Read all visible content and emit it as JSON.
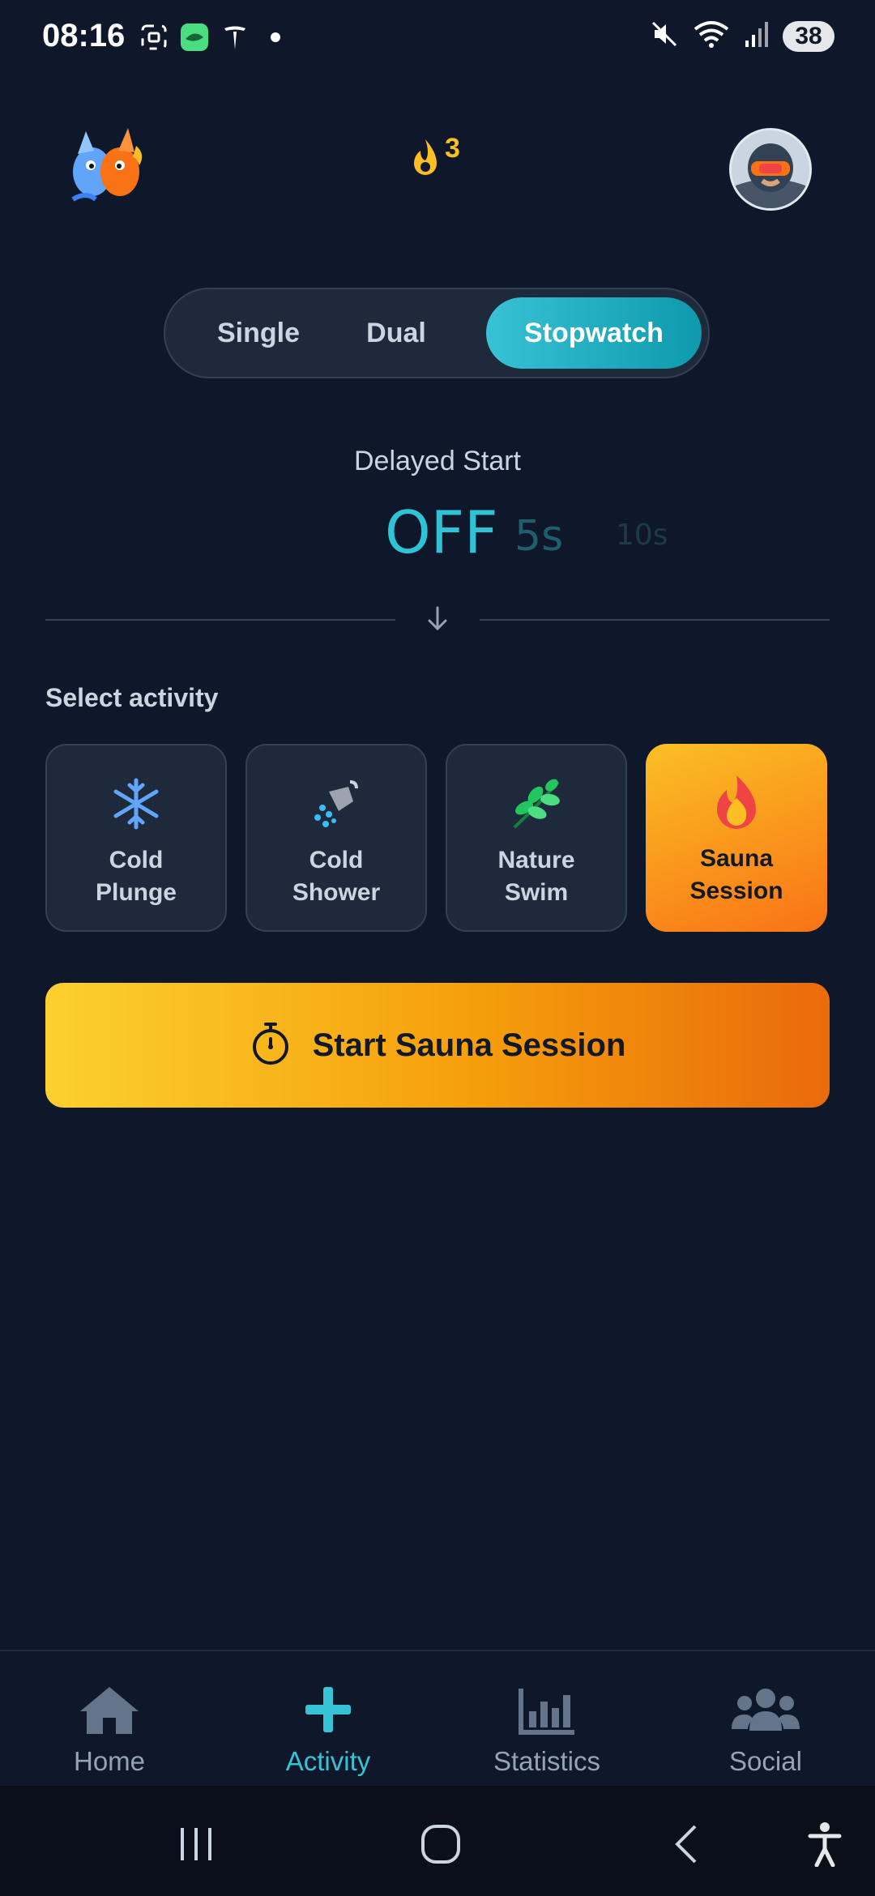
{
  "status_bar": {
    "time": "08:16",
    "battery": "38",
    "icons": [
      "screenshot-icon",
      "app-notification-icon",
      "tesla-icon",
      "dot-icon",
      "mute-icon",
      "wifi-icon",
      "signal-icon"
    ]
  },
  "header": {
    "streak_count": "3",
    "mascot": "fire-ice-dragon-mascot",
    "avatar": "user-avatar"
  },
  "mode_tabs": [
    {
      "label": "Single",
      "active": false
    },
    {
      "label": "Dual",
      "active": false
    },
    {
      "label": "Stopwatch",
      "active": true
    }
  ],
  "delayed_start": {
    "label": "Delayed Start",
    "options": [
      "OFF",
      "5s",
      "10s"
    ],
    "selected": "OFF"
  },
  "activity": {
    "label": "Select activity",
    "items": [
      {
        "label": "Cold\nPlunge",
        "icon": "snowflake-icon",
        "selected": false
      },
      {
        "label": "Cold\nShower",
        "icon": "shower-icon",
        "selected": false
      },
      {
        "label": "Nature\nSwim",
        "icon": "herb-icon",
        "selected": false
      },
      {
        "label": "Sauna\nSession",
        "icon": "fire-icon",
        "selected": true
      }
    ]
  },
  "start_button": {
    "label": "Start Sauna Session",
    "icon": "stopwatch-icon"
  },
  "bottom_nav": [
    {
      "label": "Home",
      "icon": "home-icon",
      "active": false
    },
    {
      "label": "Activity",
      "icon": "plus-icon",
      "active": true
    },
    {
      "label": "Statistics",
      "icon": "bar-chart-icon",
      "active": false
    },
    {
      "label": "Social",
      "icon": "users-icon",
      "active": false
    }
  ],
  "colors": {
    "background": "#0f172a",
    "accent_teal": "#38c2d6",
    "accent_orange": "#f59e0b",
    "streak": "#fbbf24"
  }
}
